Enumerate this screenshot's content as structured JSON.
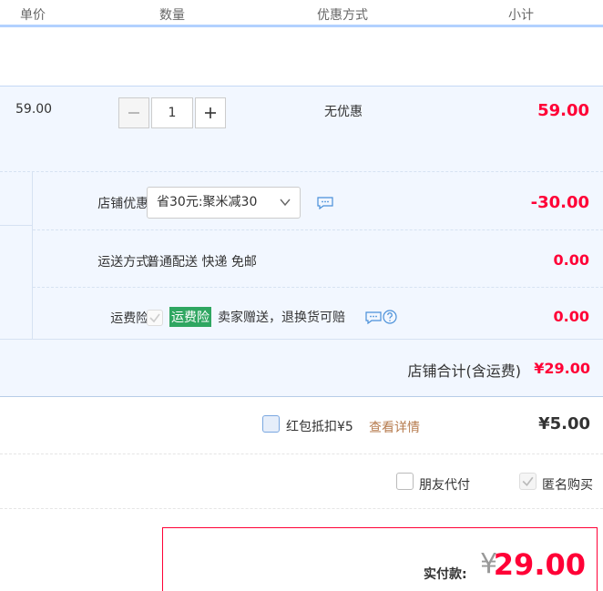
{
  "header": {
    "unit_price": "单价",
    "quantity": "数量",
    "discount_method": "优惠方式",
    "subtotal": "小计"
  },
  "item": {
    "price": "59.00",
    "quantity_value": "1",
    "promo": "无优惠",
    "subtotal": "59.00"
  },
  "shop": {
    "discount_label": "店铺优惠:",
    "discount_selected": "省30元:聚米减30",
    "discount_amount": "-30.00",
    "shipping_label": "运送方式:",
    "shipping_text": "普通配送 快递 免邮",
    "shipping_amount": "0.00",
    "insurance_label": "运费险:",
    "insurance_badge": "运费险",
    "insurance_text": "卖家赠送，退换货可赔",
    "insurance_amount": "0.00",
    "total_label": "店铺合计(含运费)",
    "total_value": "¥29.00"
  },
  "red_packet": {
    "label": "红包抵扣¥5",
    "detail_link": "查看详情",
    "amount": "¥5.00"
  },
  "options": {
    "friend_pay": "朋友代付",
    "anonymous": "匿名购买"
  },
  "payment": {
    "label": "实付款:",
    "currency": "¥",
    "value": "29.00"
  },
  "colors": {
    "accent_red": "#ff0036",
    "light_blue_bg": "#f2f7ff",
    "badge_green": "#2fa661"
  }
}
